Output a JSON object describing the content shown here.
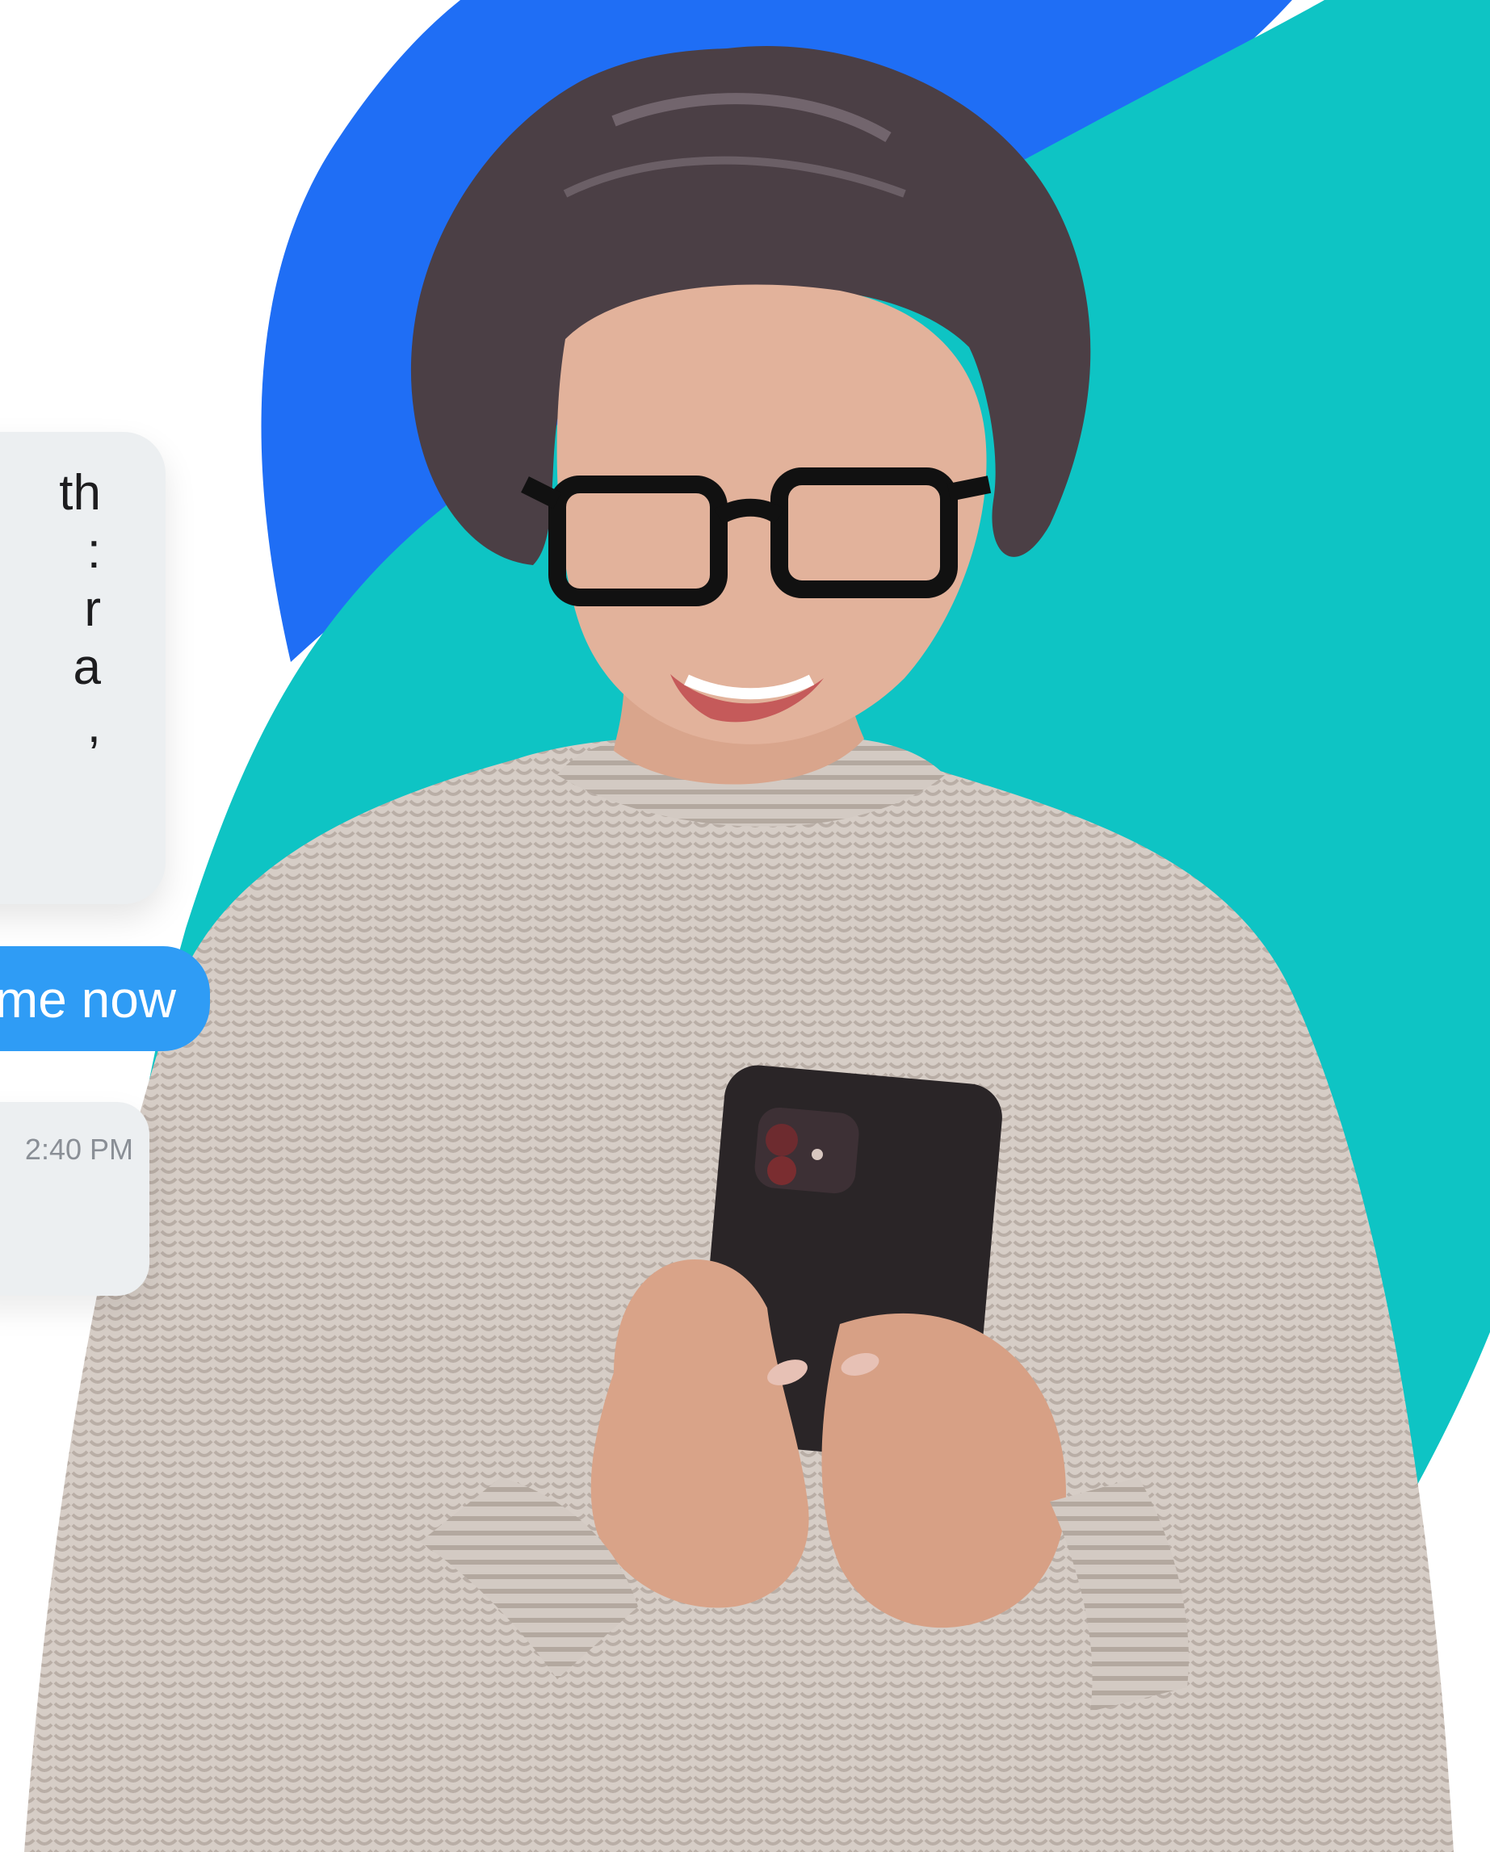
{
  "conversation": {
    "received_message_lines": [
      "th",
      "",
      "",
      "a",
      ""
    ],
    "sent_message": "me now",
    "timestamp": "2:40 PM"
  },
  "colors": {
    "bubble_received_bg": "#eceff1",
    "bubble_sent_bg": "#2f9cf5",
    "blob_blue": "#1f6ef5",
    "blob_teal": "#0ec4c4"
  },
  "photo": {
    "subject_icon": "person-using-smartphone"
  }
}
